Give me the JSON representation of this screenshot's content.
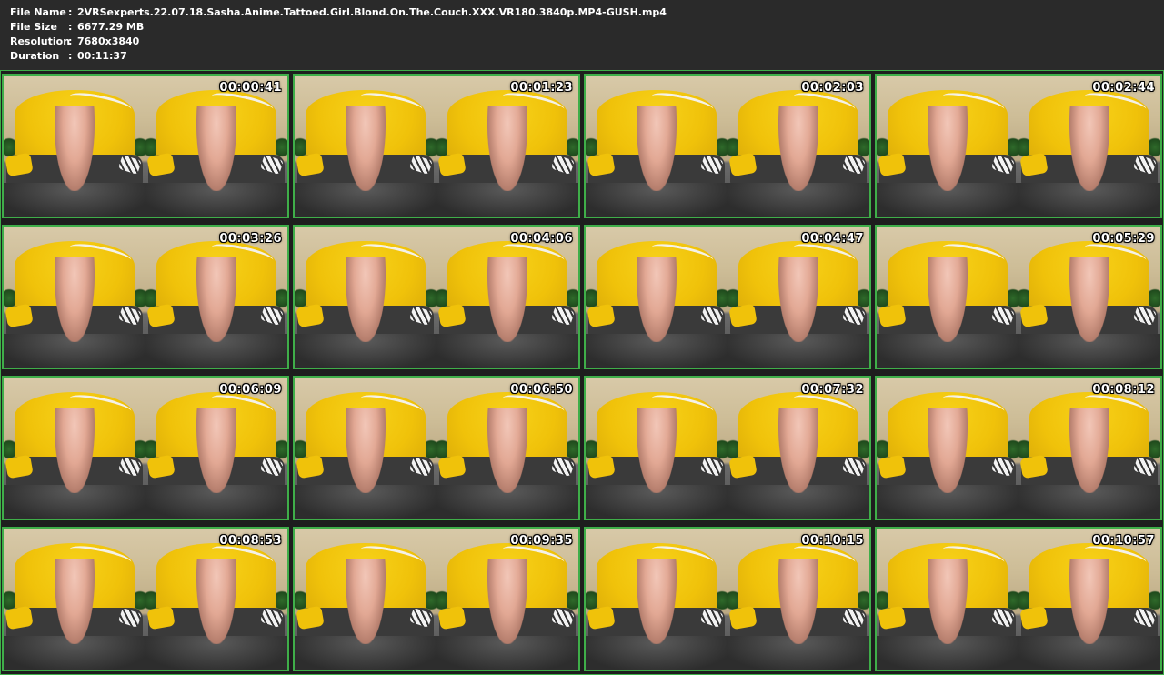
{
  "meta": {
    "separator": ":",
    "rows": [
      {
        "label": "File Name",
        "value": "2VRSexperts.22.07.18.Sasha.Anime.Tattoed.Girl.Blond.On.The.Couch.XXX.VR180.3840p.MP4-GUSH.mp4"
      },
      {
        "label": "File Size",
        "value": "6677.29 MB"
      },
      {
        "label": "Resolution",
        "value": "7680x3840"
      },
      {
        "label": "Duration",
        "value": "00:11:37"
      }
    ]
  },
  "thumbnails": [
    "00:00:41",
    "00:01:23",
    "00:02:03",
    "00:02:44",
    "00:03:26",
    "00:04:06",
    "00:04:47",
    "00:05:29",
    "00:06:09",
    "00:06:50",
    "00:07:32",
    "00:08:12",
    "00:08:53",
    "00:09:35",
    "00:10:15",
    "00:10:57"
  ],
  "colors": {
    "background": "#2a2a2a",
    "frame_border": "#3fae49",
    "text": "#ffffff"
  }
}
